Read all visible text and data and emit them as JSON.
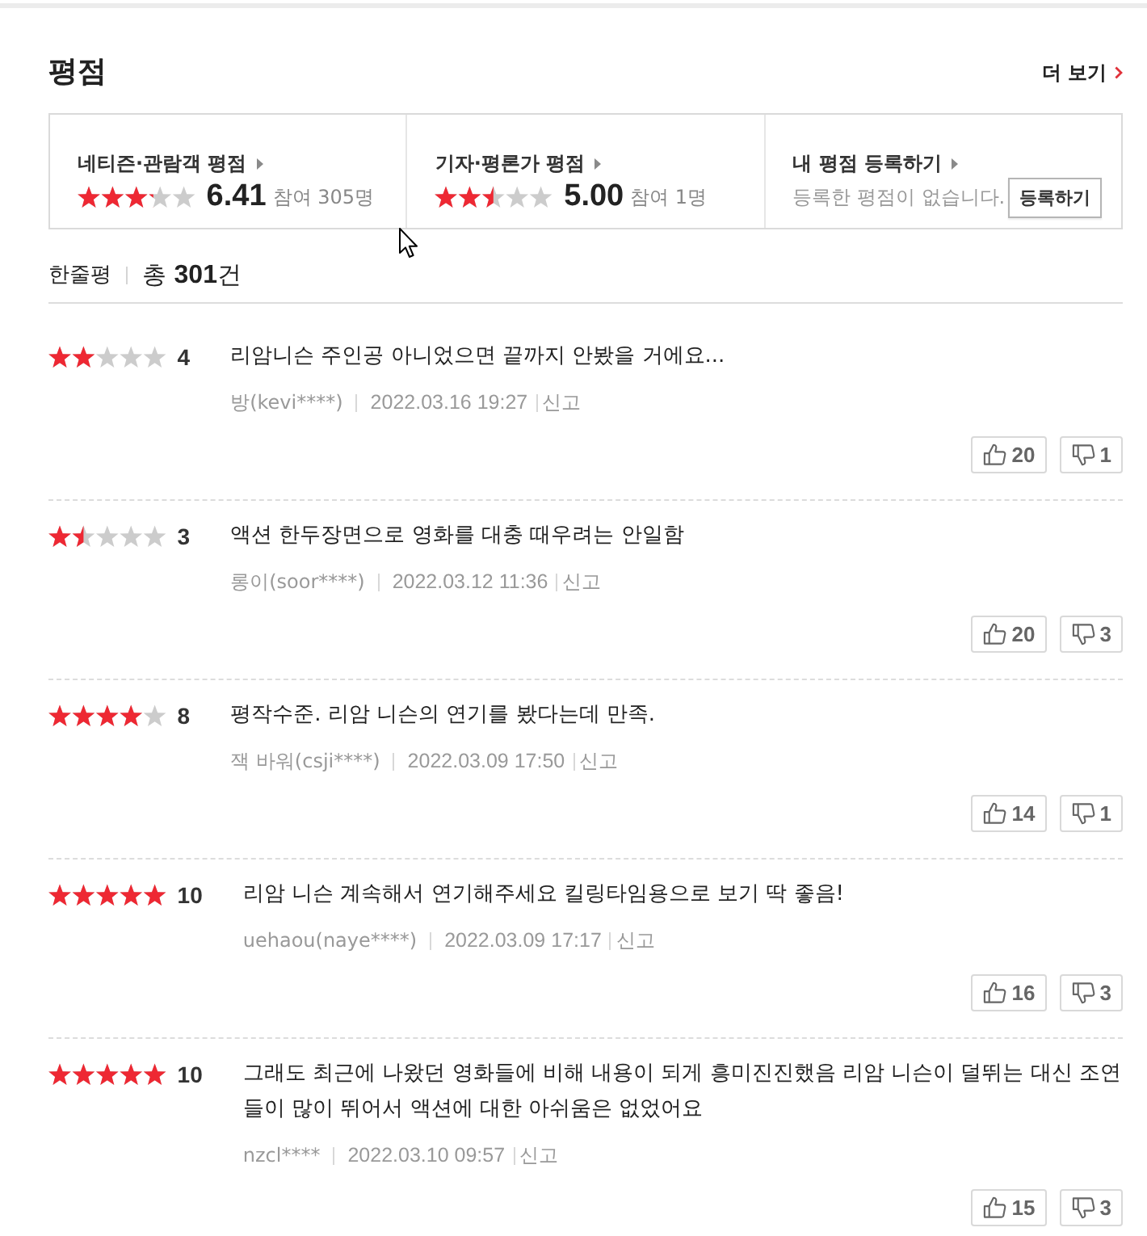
{
  "section": {
    "title": "평점",
    "more_link": "더 보기"
  },
  "rating_summary": [
    {
      "kind": "score",
      "label": "네티즌·관람객 평점",
      "stars": 3.2,
      "score": "6.41",
      "participants": "참여 305명"
    },
    {
      "kind": "score",
      "label": "기자·평론가 평점",
      "stars": 2.5,
      "score": "5.00",
      "participants": "참여 1명"
    },
    {
      "kind": "register",
      "label": "내 평점 등록하기",
      "message": "등록한 평점이 없습니다.",
      "button": "등록하기"
    }
  ],
  "comments": {
    "title": "한줄평",
    "total": "총 **301**건"
  },
  "reviews": [
    {
      "stars": 2,
      "score": "4",
      "text": "리암니슨 주인공 아니었으면 끝까지 안봤을 거에요...",
      "user": "방(kevi****)",
      "date": "2022.03.16 19:27",
      "report": "신고",
      "likes": "20",
      "dislikes": "1"
    },
    {
      "stars": 1.5,
      "score": "3",
      "text": "액션 한두장면으로 영화를 대충 때우려는 안일함",
      "user": "롱이(soor****)",
      "date": "2022.03.12 11:36",
      "report": "신고",
      "likes": "20",
      "dislikes": "3"
    },
    {
      "stars": 4,
      "score": "8",
      "text": "평작수준. 리암 니슨의 연기를 봤다는데 만족.",
      "user": "잭 바워(csji****)",
      "date": "2022.03.09 17:50",
      "report": "신고",
      "likes": "14",
      "dislikes": "1"
    },
    {
      "stars": 5,
      "score": "10",
      "text": "리암 니슨 계속해서 연기해주세요 킬링타임용으로 보기 딱 좋음!",
      "user": "uehaou(naye****)",
      "date": "2022.03.09 17:17",
      "report": "신고",
      "likes": "16",
      "dislikes": "3"
    },
    {
      "stars": 5,
      "score": "10",
      "text": "그래도 최근에 나왔던 영화들에 비해 내용이 되게 흥미진진했음 리암 니슨이 덜뛰는 대신 조연들이 많이 뛰어서 액션에 대한 아쉬움은 없었어요",
      "user": "nzcl****",
      "date": "2022.03.10 09:57",
      "report": "신고",
      "likes": "15",
      "dislikes": "3"
    }
  ]
}
